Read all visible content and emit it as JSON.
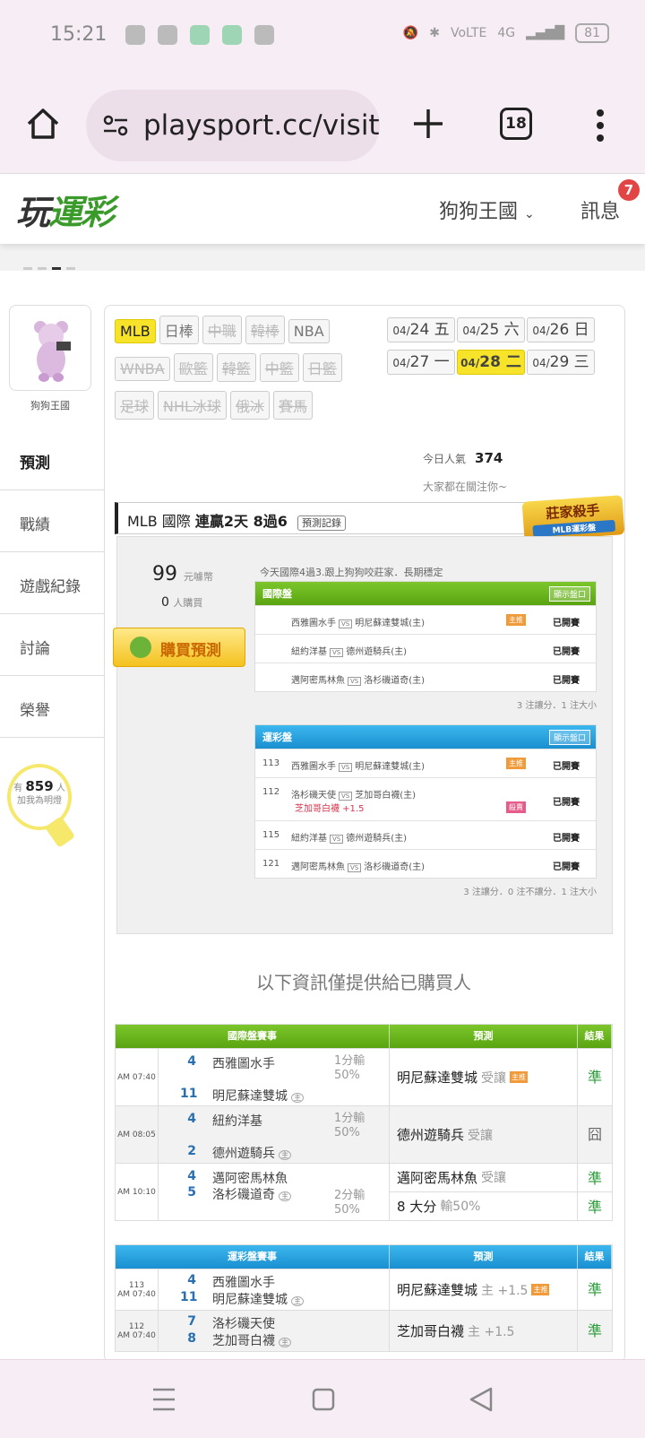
{
  "status_bar": {
    "time": "15:21",
    "battery": "81",
    "network": "4G"
  },
  "browser": {
    "url": "playsport.cc/visit",
    "tab_count": "18"
  },
  "site": {
    "logo_a": "玩",
    "logo_b": "運彩",
    "nav_kingdom": "狗狗王國",
    "nav_messages": "訊息",
    "message_count": "7"
  },
  "profile": {
    "name": "狗狗王國"
  },
  "sidebar_tabs": [
    "預測",
    "戰績",
    "遊戲紀錄",
    "討論",
    "榮譽"
  ],
  "fans": {
    "prefix": "有",
    "count": "859",
    "suffix": "人",
    "sub": "加我為明燈"
  },
  "leagues": [
    {
      "label": "MLB",
      "state": "sel"
    },
    {
      "label": "日棒",
      "state": ""
    },
    {
      "label": "中職",
      "state": "dis"
    },
    {
      "label": "韓棒",
      "state": "dis"
    },
    {
      "label": "NBA",
      "state": ""
    },
    {
      "label": "WNBA",
      "state": "dis"
    },
    {
      "label": "歐籃",
      "state": "dis"
    },
    {
      "label": "韓籃",
      "state": "dis"
    },
    {
      "label": "中籃",
      "state": "dis"
    },
    {
      "label": "日籃",
      "state": "dis"
    },
    {
      "label": "足球",
      "state": "dis"
    },
    {
      "label": "NHL冰球",
      "state": "dis"
    },
    {
      "label": "俄冰",
      "state": "dis"
    },
    {
      "label": "賽馬",
      "state": "dis"
    }
  ],
  "dates": [
    {
      "md": "04/",
      "day": "24 五",
      "sel": false
    },
    {
      "md": "04/",
      "day": "25 六",
      "sel": false
    },
    {
      "md": "04/",
      "day": "26 日",
      "sel": false
    },
    {
      "md": "04/",
      "day": "27 一",
      "sel": false
    },
    {
      "md": "04/",
      "day": "28 二",
      "sel": true
    },
    {
      "md": "04/",
      "day": "29 三",
      "sel": false
    }
  ],
  "popularity": {
    "label": "今日人氣",
    "value": "374",
    "watching": "大家都在關注你~"
  },
  "mlb_bar": {
    "league": "MLB 國際",
    "streak": "連贏2天 8過6",
    "record_btn": "預測記錄"
  },
  "killer_badge": {
    "title": "莊家殺手",
    "sub": "MLB運彩盤",
    "ribbon": "長期穩定"
  },
  "purchase": {
    "price": "99",
    "price_unit": "元噱幣",
    "buyers": "0",
    "buyers_unit": "人購買",
    "buy_button": "購買預測",
    "note": "今天國際4過3.跟上狗狗咬莊家．長期穩定"
  },
  "intl_table": {
    "title": "國際盤",
    "show_btn": "顯示盤口",
    "rows": [
      {
        "away": "西雅圖水手",
        "home": "明尼蘇達雙城(主)",
        "tag": "主推",
        "status": "已開賽"
      },
      {
        "away": "紐約洋基",
        "home": "德州遊騎兵(主)",
        "tag": "",
        "status": "已開賽"
      },
      {
        "away": "邁阿密馬林魚",
        "home": "洛杉磯道奇(主)",
        "tag": "",
        "status": "已開賽"
      }
    ],
    "footer": "3 注讓分．1 注大小"
  },
  "lottery_table": {
    "title": "運彩盤",
    "show_btn": "顯示盤口",
    "rows": [
      {
        "num": "113",
        "away": "西雅圖水手",
        "home": "明尼蘇達雙城(主)",
        "tag": "主推",
        "extra": "",
        "status": "已開賽"
      },
      {
        "num": "112",
        "away": "洛杉磯天使",
        "home": "芝加哥白襪(主)",
        "tag": "殺賣",
        "extra": "芝加哥白襪 +1.5",
        "status": "已開賽"
      },
      {
        "num": "115",
        "away": "紐約洋基",
        "home": "德州遊騎兵(主)",
        "tag": "",
        "extra": "",
        "status": "已開賽"
      },
      {
        "num": "121",
        "away": "邁阿密馬林魚",
        "home": "洛杉磯道奇(主)",
        "tag": "",
        "extra": "",
        "status": "已開賽"
      }
    ],
    "footer": "3 注讓分．0 注不讓分．1 注大小"
  },
  "notice": "以下資訊僅提供給已購買人",
  "results_intl": {
    "headers": [
      "國際盤賽事",
      "預測",
      "結果"
    ],
    "rows": [
      {
        "time": "AM 07:40",
        "s1": "4",
        "t1": "西雅圖水手",
        "s2": "11",
        "t2": "明尼蘇達雙城",
        "line": "1分輸",
        "pct": "50%",
        "pick": "明尼蘇達雙城",
        "pick_note": "受讓",
        "pick_tag": "主推",
        "result": "準"
      },
      {
        "time": "AM 08:05",
        "s1": "4",
        "t1": "紐約洋基",
        "s2": "2",
        "t2": "德州遊騎兵",
        "line": "1分輸",
        "pct": "50%",
        "pick": "德州遊騎兵",
        "pick_note": "受讓",
        "pick_tag": "",
        "result": "囧"
      },
      {
        "time": "AM 10:10",
        "s1": "4",
        "t1": "邁阿密馬林魚",
        "s2": "5",
        "t2": "洛杉磯道奇",
        "line": "2分輸",
        "pct": "50%",
        "pick": "邁阿密馬林魚",
        "pick_note": "受讓",
        "pick2": "8 大分",
        "pick2_note": "輸50%",
        "result": "準",
        "result2": "準"
      }
    ]
  },
  "results_lottery": {
    "headers": [
      "運彩盤賽事",
      "預測",
      "結果"
    ],
    "rows": [
      {
        "num": "113",
        "time": "AM 07:40",
        "s1": "4",
        "t1": "西雅圖水手",
        "s2": "11",
        "t2": "明尼蘇達雙城",
        "pick": "明尼蘇達雙城",
        "pick_note": "主 +1.5",
        "pick_tag": "主推",
        "result": "準"
      },
      {
        "num": "112",
        "time": "AM 07:40",
        "s1": "7",
        "t1": "洛杉磯天使",
        "s2": "8",
        "t2": "芝加哥白襪",
        "pick": "芝加哥白襪",
        "pick_note": "主 +1.5",
        "pick_tag": "",
        "result": "準"
      }
    ]
  },
  "home_marker": "主",
  "vs_label": "VS",
  "colors": {
    "accent_green": "#5aa412",
    "accent_blue": "#1a8fd0",
    "selected_yellow": "#f6e32a",
    "win_green": "#2a9d3a"
  }
}
